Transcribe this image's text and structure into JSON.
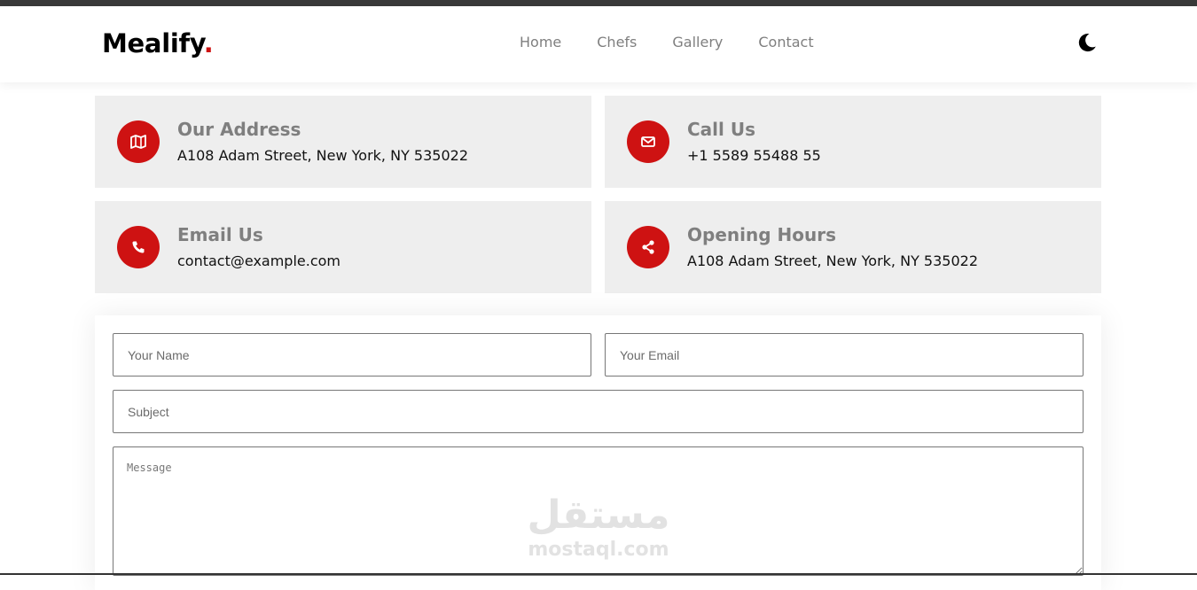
{
  "header": {
    "logo_text": "Mealify",
    "logo_dot": ".",
    "nav": [
      "Home",
      "Chefs",
      "Gallery",
      "Contact"
    ],
    "theme_toggle_icon": "moon-icon"
  },
  "info_cards": [
    {
      "title": "Our Address",
      "text": "A108 Adam Street, New York, NY 535022",
      "icon": "map-icon"
    },
    {
      "title": "Call Us",
      "text": "+1 5589 55488 55",
      "icon": "envelope-icon"
    },
    {
      "title": "Email Us",
      "text": "contact@example.com",
      "icon": "phone-icon"
    },
    {
      "title": "Opening Hours",
      "text": "A108 Adam Street, New York, NY 535022",
      "icon": "share-icon"
    }
  ],
  "form": {
    "name_placeholder": "Your Name",
    "email_placeholder": "Your Email",
    "subject_placeholder": "Subject",
    "message_placeholder": "Message",
    "name_value": "",
    "email_value": "",
    "subject_value": "",
    "message_value": ""
  },
  "watermark": {
    "arabic": "مستقل",
    "latin": "mostaql.com"
  },
  "colors": {
    "accent": "#ce1212",
    "card_bg": "#eeeeee",
    "muted_text": "#7f7f7f"
  }
}
